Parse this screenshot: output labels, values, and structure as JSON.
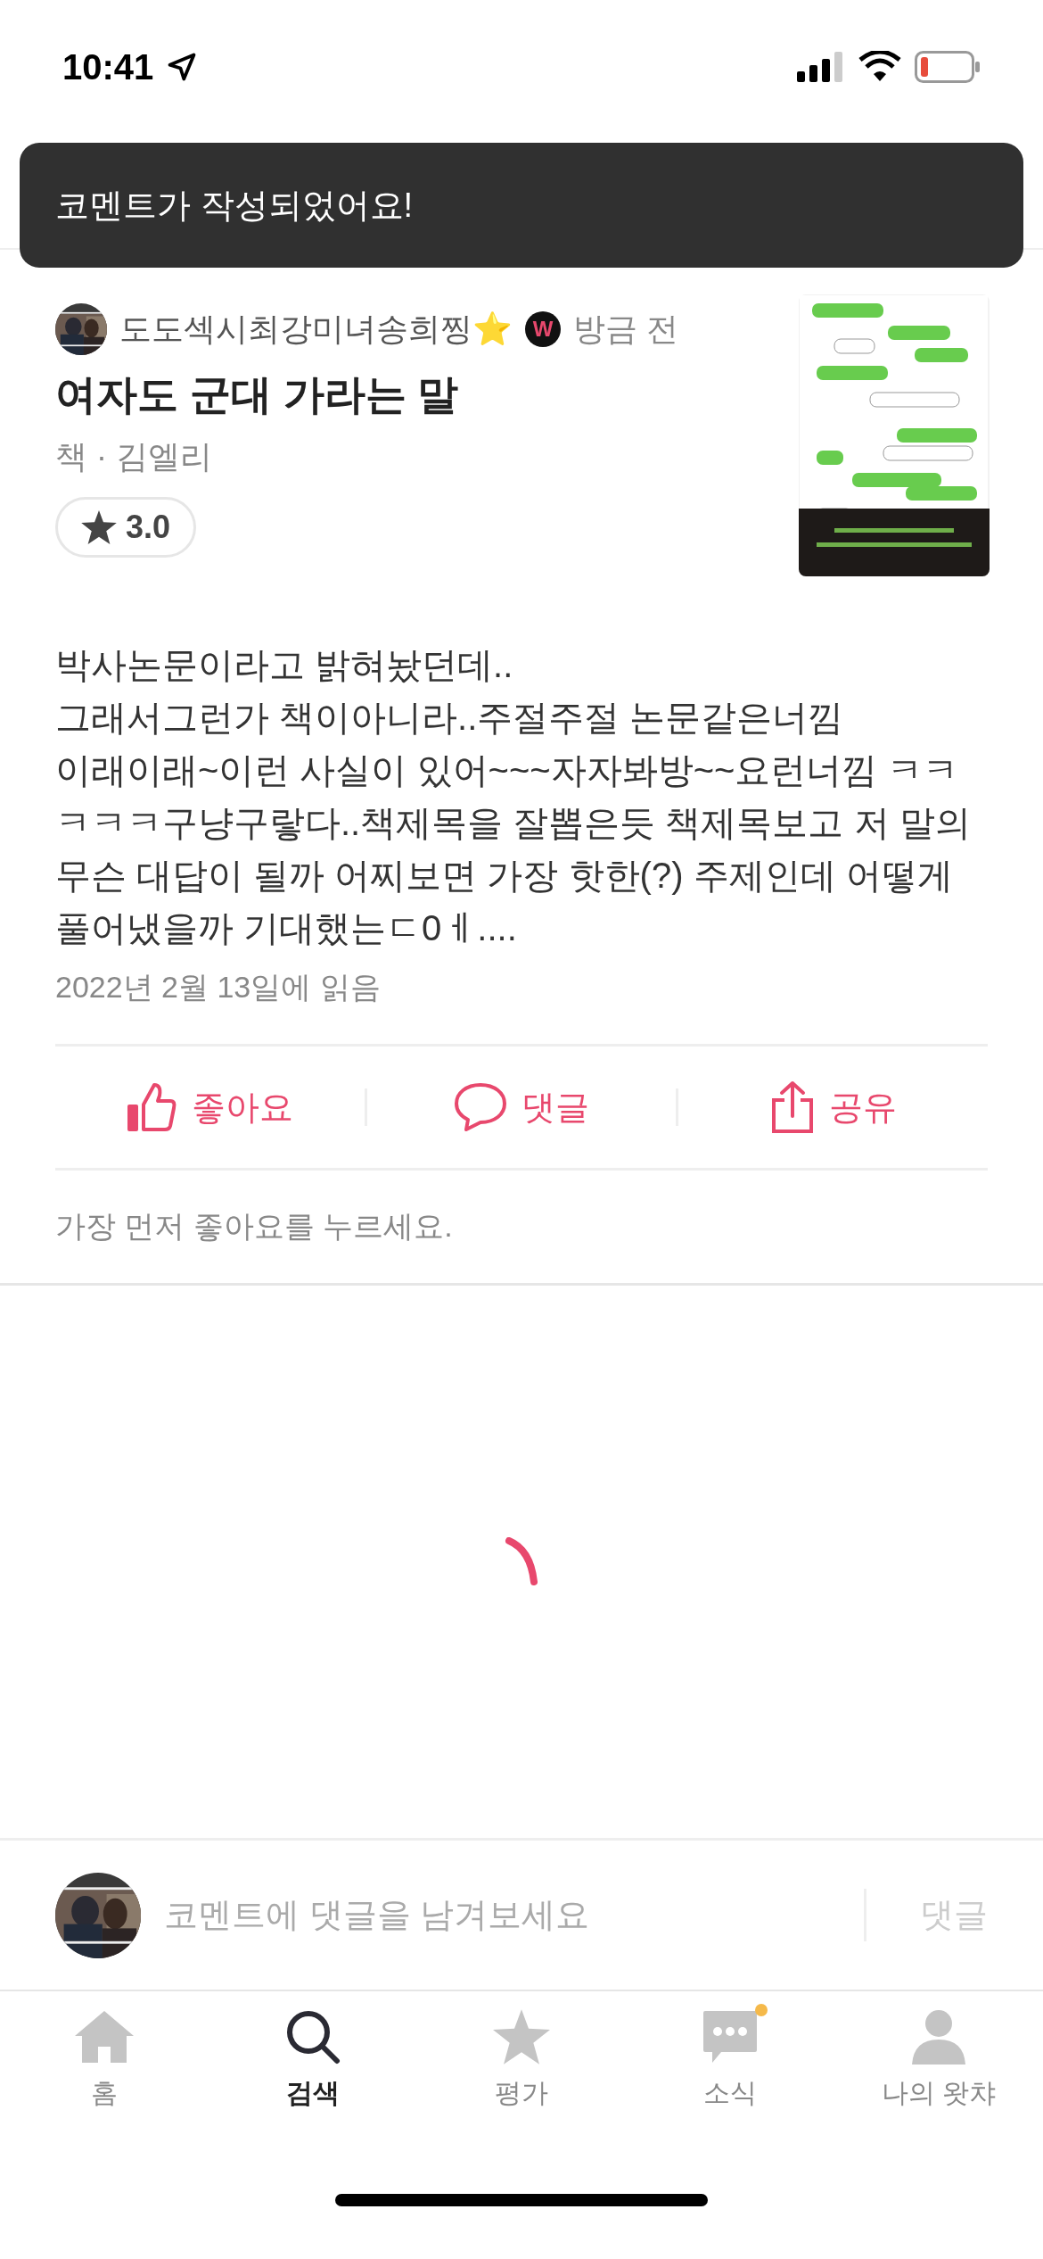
{
  "status_bar": {
    "time": "10:41"
  },
  "toast": {
    "message": "코멘트가 작성되었어요!"
  },
  "comment": {
    "author": "도도섹시최강미녀송희찡",
    "author_emoji": "⭐️",
    "badge": "W",
    "time": "방금 전",
    "title": "여자도 군대 가라는 말",
    "meta": "책 · 김엘리",
    "rating": "3.0",
    "body": "박사논문이라고 밝혀놨던데..\n그래서그런가 책이아니라..주절주절 논문같은너낌\n이래이래~이런 사실이 있어~~~자자봐방~~요런너낌 ㅋㅋㅋㅋㅋ구냥구랗다..책제목을 잘뽑은듯 책제목보고 저 말의 무슨 대답이 될까 어찌보면 가장 핫한(?) 주제인데 어떻게 풀어냈을까 기대했는ㄷ0ㅔ....",
    "read_date": "2022년 2월 13일에 읽음"
  },
  "actions": [
    {
      "kind": "like",
      "label": "좋아요"
    },
    {
      "kind": "reply",
      "label": "댓글"
    },
    {
      "kind": "share",
      "label": "공유"
    }
  ],
  "like_hint": "가장 먼저 좋아요를 누르세요.",
  "reply_bar": {
    "placeholder": "코멘트에 댓글을 남겨보세요",
    "button": "댓글"
  },
  "tabs": [
    {
      "kind": "home",
      "label": "홈",
      "selected": false,
      "notification": false
    },
    {
      "kind": "search",
      "label": "검색",
      "selected": true,
      "notification": false
    },
    {
      "kind": "rate",
      "label": "평가",
      "selected": false,
      "notification": false
    },
    {
      "kind": "news",
      "label": "소식",
      "selected": false,
      "notification": true
    },
    {
      "kind": "profile",
      "label": "나의 왓챠",
      "selected": false,
      "notification": false
    }
  ]
}
